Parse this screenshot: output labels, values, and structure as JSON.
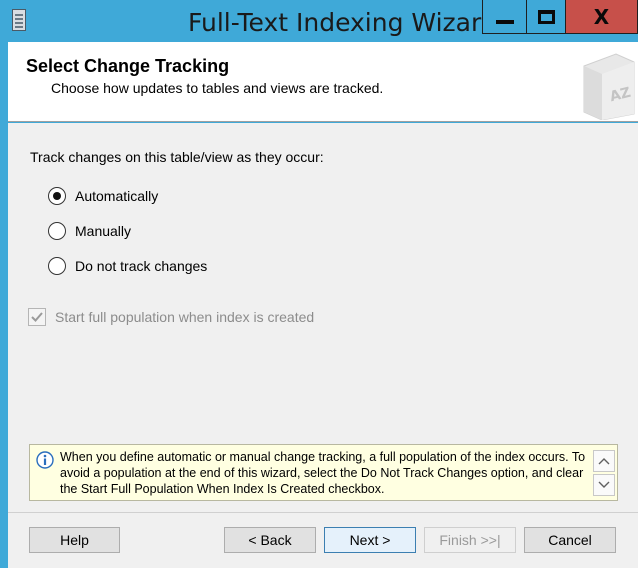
{
  "window": {
    "title": "Full-Text Indexing Wizard",
    "minimize_icon": "minimize-icon",
    "maximize_icon": "maximize-icon",
    "close_glyph": "X"
  },
  "header": {
    "title": "Select Change Tracking",
    "subtitle": "Choose how updates to tables and views are tracked.",
    "illustration_text": "AZ"
  },
  "body": {
    "track_label": "Track changes on this table/view as they occur:",
    "options": [
      {
        "label": "Automatically",
        "checked": true
      },
      {
        "label": "Manually",
        "checked": false
      },
      {
        "label": "Do not track changes",
        "checked": false
      }
    ],
    "start_population": {
      "label": "Start full population when index is created",
      "checked": true,
      "enabled": false
    }
  },
  "info": {
    "text": "When you define automatic or manual change tracking, a full population of the index occurs. To avoid a population at the end of this wizard, select the Do Not Track Changes option, and clear the Start Full Population When Index Is Created checkbox."
  },
  "buttons": {
    "help": "Help",
    "back": "< Back",
    "next": "Next >",
    "finish": "Finish >>|",
    "cancel": "Cancel"
  },
  "colors": {
    "titlebar": "#3fa9d8",
    "close_button": "#c7504a",
    "info_background": "#ffffe1",
    "dialog_background": "#f0f0f0"
  }
}
